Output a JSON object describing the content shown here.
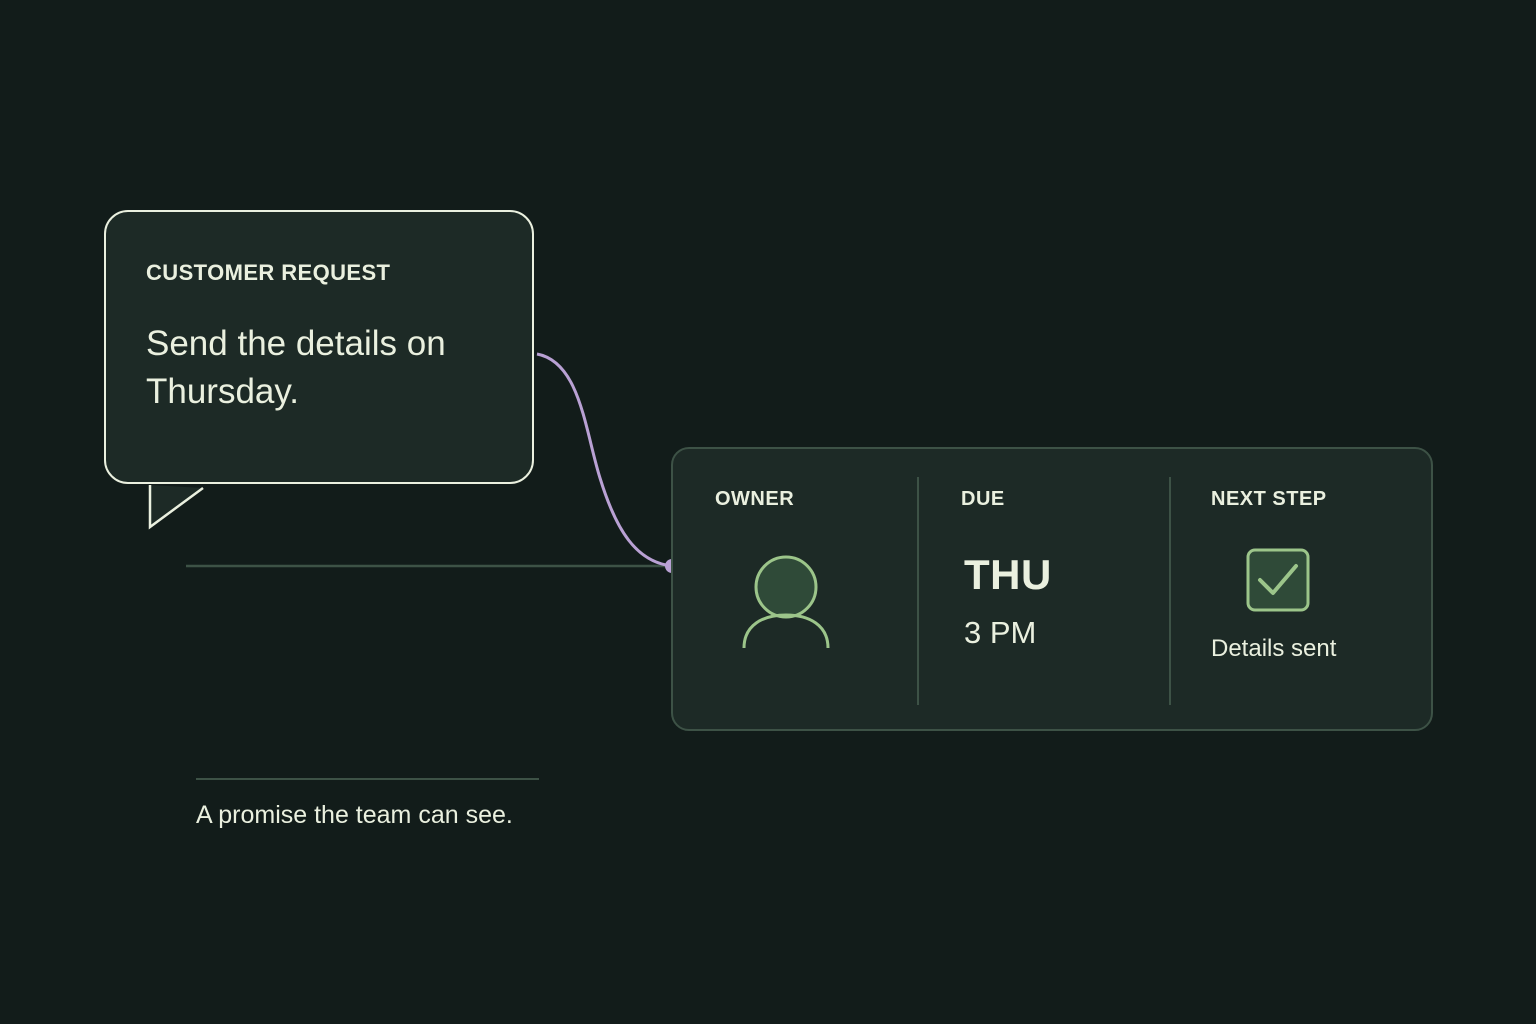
{
  "request": {
    "label": "CUSTOMER REQUEST",
    "text": "Send the details on Thursday."
  },
  "task": {
    "owner": {
      "label": "OWNER",
      "icon": "person-icon"
    },
    "due": {
      "label": "DUE",
      "day": "THU",
      "time": "3 PM"
    },
    "next_step": {
      "label": "NEXT STEP",
      "icon": "checkbox-checked-icon",
      "status": "Details sent"
    }
  },
  "caption": "A promise the team can see.",
  "colors": {
    "background": "#121c1a",
    "card": "#1d2a26",
    "text": "#eaf0df",
    "connector": "#b9a1d4",
    "accent_green": "#9cc58a",
    "muted_line": "#3d5246"
  }
}
